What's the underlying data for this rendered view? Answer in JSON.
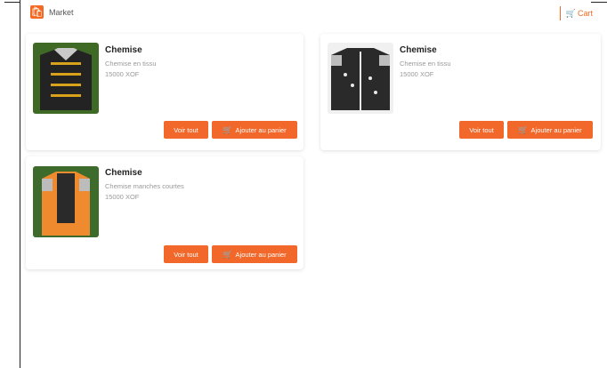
{
  "header": {
    "logo_glyph": "🛍",
    "title": "Market",
    "cart_label": "Cart",
    "cart_glyph": "🛒"
  },
  "products": [
    {
      "name": "Chemise",
      "description": "Chemise en tissu",
      "price": "15000 XOF",
      "view_label": "Voir tout",
      "add_label": "Ajouter au panier",
      "colors": {
        "field": "#3f6a26",
        "body": "#232323",
        "sleeve": "#c9c9c9",
        "accent": "#d9a21b"
      }
    },
    {
      "name": "Chemise",
      "description": "Chemise en tissu",
      "price": "15000 XOF",
      "view_label": "Voir tout",
      "add_label": "Ajouter au panier",
      "colors": {
        "field": "#f0f0f0",
        "body": "#2a2a2a",
        "sleeve": "#bdbdbd",
        "accent": "#e8e8e8"
      }
    },
    {
      "name": "Chemise",
      "description": "Chemise manches courtes",
      "price": "15000 XOF",
      "view_label": "Voir tout",
      "add_label": "Ajouter au panier",
      "colors": {
        "field": "#3c6b2c",
        "body": "#f08a2e",
        "sleeve": "#bcbcbc",
        "accent": "#2a2a2a"
      }
    }
  ]
}
